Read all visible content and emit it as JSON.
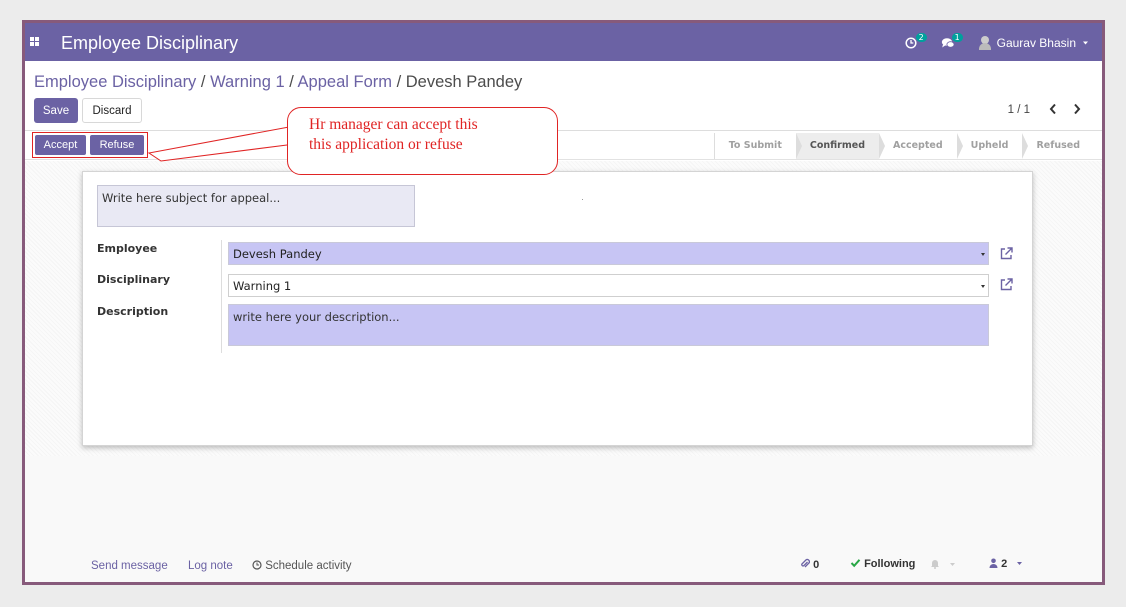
{
  "navbar": {
    "app_title": "Employee Disciplinary",
    "activity_count": "2",
    "message_count": "1",
    "user_name": "Gaurav Bhasin"
  },
  "breadcrumb": {
    "items": [
      "Employee Disciplinary",
      "Warning 1",
      "Appeal Form"
    ],
    "separator": "/",
    "current": "Devesh Pandey"
  },
  "toolbar": {
    "save_label": "Save",
    "discard_label": "Discard"
  },
  "pager": {
    "value": "1 / 1"
  },
  "actions": {
    "accept_label": "Accept",
    "refuse_label": "Refuse"
  },
  "stages": [
    {
      "label": "To Submit",
      "active": false
    },
    {
      "label": "Confirmed",
      "active": true
    },
    {
      "label": "Accepted",
      "active": false
    },
    {
      "label": "Upheld",
      "active": false
    },
    {
      "label": "Refused",
      "active": false
    }
  ],
  "callout": {
    "line1": "Hr manager can accept this",
    "line2": "this application or refuse"
  },
  "form": {
    "subject_placeholder": "Write here subject for appeal...",
    "employee_label": "Employee",
    "employee_value": "Devesh Pandey",
    "disciplinary_label": "Disciplinary",
    "disciplinary_value": "Warning 1",
    "description_label": "Description",
    "description_placeholder": "write here your description..."
  },
  "chatter": {
    "send_message": "Send message",
    "log_note": "Log note",
    "schedule_activity": "Schedule activity",
    "attachments_count": "0",
    "following_label": "Following",
    "followers_count": "2"
  },
  "colors": {
    "brand": "#6b62a4",
    "highlight_red": "#e02424",
    "required_field": "#c7c5f4",
    "frame": "#875a7b"
  }
}
